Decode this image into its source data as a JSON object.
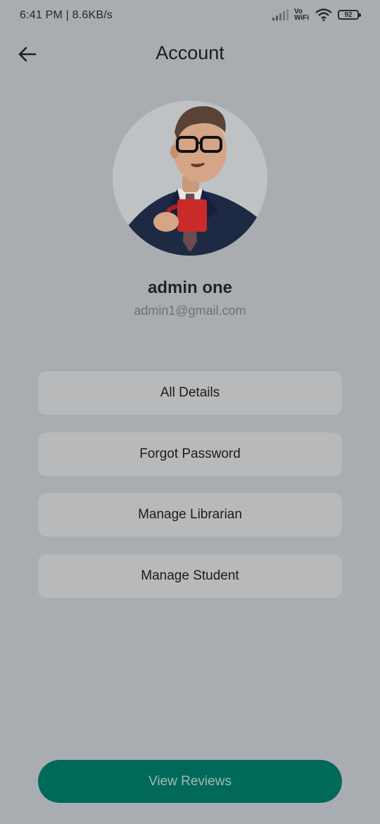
{
  "status_bar": {
    "time": "6:41 PM | 8.6KB/s",
    "network_label_line1": "Vo",
    "network_label_line2": "WiFi",
    "battery": "92"
  },
  "app_bar": {
    "title": "Account",
    "back_icon": "arrow-left-icon"
  },
  "profile": {
    "name": "admin one",
    "email": "admin1@gmail.com",
    "avatar_icon": "cartoon-man-with-mug-avatar"
  },
  "menu": {
    "items": [
      {
        "label": "All Details"
      },
      {
        "label": "Forgot Password"
      },
      {
        "label": "Manage Librarian"
      },
      {
        "label": "Manage Student"
      }
    ]
  },
  "footer": {
    "primary_label": "View Reviews"
  },
  "colors": {
    "overlay_background": "#a9adb1",
    "primary": "#00695a",
    "menu_button": "#b7b9bb"
  }
}
